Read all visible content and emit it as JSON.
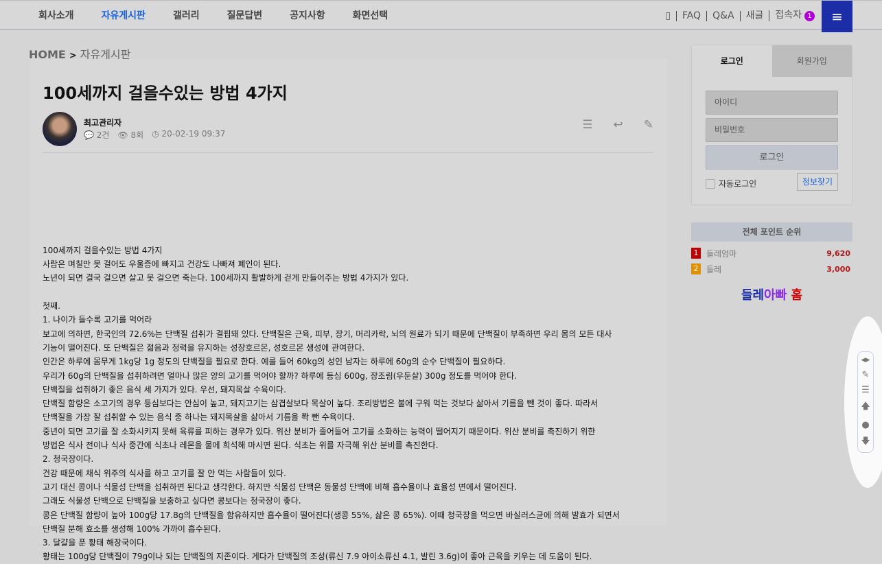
{
  "nav": {
    "items": [
      "회사소개",
      "자유게시판",
      "갤러리",
      "질문답변",
      "공지사항",
      "화면선택"
    ],
    "active": 1
  },
  "util": {
    "mobile_icon": "▯",
    "faq": "FAQ",
    "qna": "Q&A",
    "new": "새글",
    "visitors": "접속자",
    "visitor_count": "1",
    "menu_icon": "≡"
  },
  "breadcrumb": {
    "home": "HOME",
    "sep": ">",
    "current": "자유게시판"
  },
  "post": {
    "title": "100세까지 걸을수있는 방법 4가지",
    "author": "최고관리자",
    "comments": "2건",
    "views": "8회",
    "date": "20-02-19 09:37",
    "body": [
      "",
      "",
      "",
      "100세까지 걸을수있는 방법 4가지",
      "사람은 며칠만 못 걸어도 우울증에 빠지고 건강도 나빠져 폐인이 된다.",
      "노년이 되면 결국 걸으면 살고 못 걸으면 죽는다. 100세까지 활발하게 걷게 만들어주는 방법 4가지가 있다.",
      "",
      "첫째.",
      "1. 나이가 들수록 고기를 먹어라",
      "보고에 의하면, 한국인의 72.6%는 단백질 섭취가 결핍돼 있다. 단백질은 근육, 피부, 장기, 머리카락, 뇌의 원료가 되기 때문에 단백질이 부족하면 우리 몸의 모든 대사",
      "기능이 떨어진다. 또 단백질은 젊음과 정력을 유지하는 성장호르몬, 성호르몬 생성에 관여한다.",
      "인간은 하루에 몸무게 1kg당 1g 정도의 단백질을 필요로 한다. 예를 들어 60kg의 성인 남자는 하루에 60g의 순수 단백질이 필요하다.",
      "우리가 60g의 단백질을 섭취하려면 얼마나 많은 양의 고기를 먹어야 할까? 하루에 등심 600g, 장조림(우둔살) 300g 정도를 먹어야 한다.",
      "단백질을 섭취하기 좋은 음식 세 가지가 있다. 우선, 돼지목살 수육이다.",
      "단백질 함량은 소고기의 경우 등심보다는 안심이 높고, 돼지고기는 삼겹살보다 목살이 높다. 조리방법은 불에 구워 먹는 것보다 삶아서 기름을 뺀 것이 좋다. 따라서",
      "단백질을 가장 잘 섭취할 수 있는 음식 중 하나는 돼지목살을 삶아서 기름을 쫙 뺀 수육이다.",
      "중년이 되면 고기를 잘 소화시키지 못해 육류를 피하는 경우가 있다. 위산 분비가 줄어들어 고기를 소화하는 능력이 떨어지기 때문이다. 위산 분비를 촉진하기 위한",
      "방법은 식사 전이나 식사 중간에 식초나 레몬을 물에 희석해 마시면 된다. 식초는 위를 자극해 위산 분비를 촉진한다.",
      "2. 청국장이다.",
      "건강 때문에 채식 위주의 식사를 하고 고기를 잘 안 먹는 사람들이 있다.",
      "고기 대신 콩이나 식물성 단백을 섭취하면 된다고 생각한다. 하지만 식물성 단백은 동물성 단백에 비해 흡수율이나 효율성 면에서 떨어진다.",
      "그래도 식물성 단백으로 단백질을 보충하고 싶다면 콩보다는 청국장이 좋다.",
      "콩은 단백질 함량이 높아 100g당 17.8g의 단백질을 함유하지만 흡수율이 떨어진다(생콩 55%, 삶은 콩 65%). 이때 청국장을 먹으면 바실러스균에 의해 발효가 되면서",
      "단백질 분해 효소를 생성해 100% 가까이 흡수된다.",
      "3. 달걀을 푼 황태 해장국이다.",
      "황태는 100g당 단백질이 79g이나 되는 단백질의 지존이다. 게다가 단백질의 조성(류신 7.9 아이소류신 4.1, 발린 3.6g)이 좋아 근육을 키우는 데 도움이 된다."
    ]
  },
  "login": {
    "tab_login": "로그인",
    "tab_join": "회원가입",
    "id_placeholder": "아이디",
    "pw_placeholder": "비밀번호",
    "submit": "로그인",
    "auto": "자동로그인",
    "find": "정보찾기"
  },
  "ranking": {
    "title": "전체 포인트 순위",
    "items": [
      {
        "rank": "1",
        "name": "들레엄마",
        "points": "9,620",
        "color": "#c00000"
      },
      {
        "rank": "2",
        "name": "들레",
        "points": "3,000",
        "color": "#e09000"
      }
    ]
  },
  "home_link": {
    "part1": "들레",
    "part2": "아빠",
    "part3": "홈"
  }
}
